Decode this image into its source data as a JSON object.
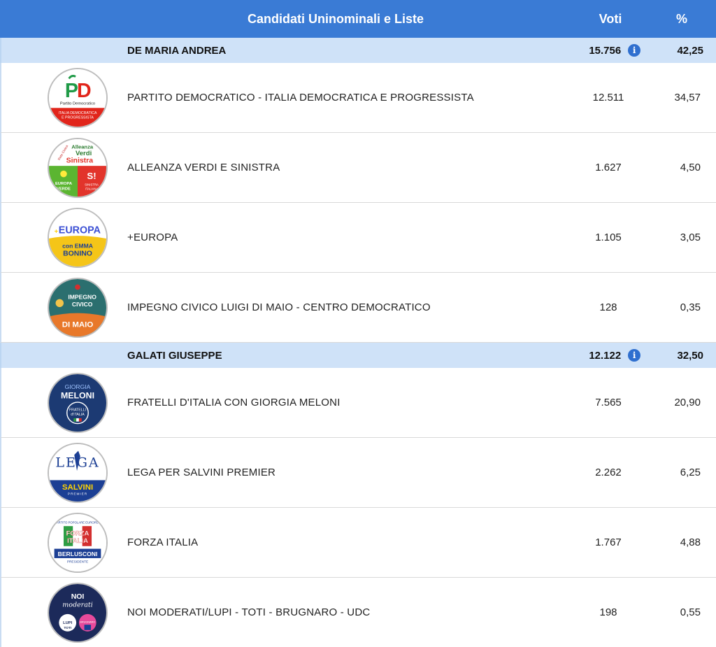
{
  "header": {
    "title": "Candidati Uninominali e Liste",
    "votes": "Voti",
    "pct": "%"
  },
  "candidates": [
    {
      "name": "DE MARIA ANDREA",
      "votes": "15.756",
      "pct": "42,25",
      "lists": [
        {
          "name": "PARTITO DEMOCRATICO - ITALIA DEMOCRATICA E PROGRESSISTA",
          "votes": "12.511",
          "pct": "34,57",
          "logo_text": [
            "Partito Democratico",
            "ITALIA DEMOCRATICA",
            "E PROGRESSISTA"
          ],
          "logo_mark": "PD"
        },
        {
          "name": "ALLEANZA VERDI E SINISTRA",
          "votes": "1.627",
          "pct": "4,50",
          "logo_text": [
            "Alleanza",
            "Verdi",
            "Sinistra",
            "EUROPA VERDE",
            "SINISTRA ITALIANA",
            "Rete Civica"
          ],
          "logo_mark": "SI"
        },
        {
          "name": "+EUROPA",
          "votes": "1.105",
          "pct": "3,05",
          "logo_text": [
            "EUROPA",
            "con EMMA",
            "BONINO"
          ],
          "logo_mark": "+"
        },
        {
          "name": "IMPEGNO CIVICO LUIGI DI MAIO - CENTRO DEMOCRATICO",
          "votes": "128",
          "pct": "0,35",
          "logo_text": [
            "IMPEGNO",
            "CIVICO",
            "DI MAIO"
          ],
          "logo_mark": ""
        }
      ]
    },
    {
      "name": "GALATI GIUSEPPE",
      "votes": "12.122",
      "pct": "32,50",
      "lists": [
        {
          "name": "FRATELLI D'ITALIA CON GIORGIA MELONI",
          "votes": "7.565",
          "pct": "20,90",
          "logo_text": [
            "GIORGIA",
            "MELONI",
            "FRATELLI",
            "d'ITALIA"
          ],
          "logo_mark": ""
        },
        {
          "name": "LEGA PER SALVINI PREMIER",
          "votes": "2.262",
          "pct": "6,25",
          "logo_text": [
            "LEGA",
            "SALVINI",
            "PREMIER"
          ],
          "logo_mark": ""
        },
        {
          "name": "FORZA ITALIA",
          "votes": "1.767",
          "pct": "4,88",
          "logo_text": [
            "PARTITO POPOLARE EUROPEO",
            "FORZA",
            "ITALIA",
            "BERLUSCONI",
            "PRESIDENTE"
          ],
          "logo_mark": ""
        },
        {
          "name": "NOI MODERATI/LUPI - TOTI - BRUGNARO - UDC",
          "votes": "198",
          "pct": "0,55",
          "logo_text": [
            "NOI",
            "moderati",
            "LUPI",
            "TOTI",
            "BRUGNARO"
          ],
          "logo_mark": ""
        }
      ]
    }
  ],
  "colors": {
    "header_bg": "#3a7bd5",
    "candidate_bg": "#cfe2f8",
    "info_icon": "#2f6fcf"
  }
}
